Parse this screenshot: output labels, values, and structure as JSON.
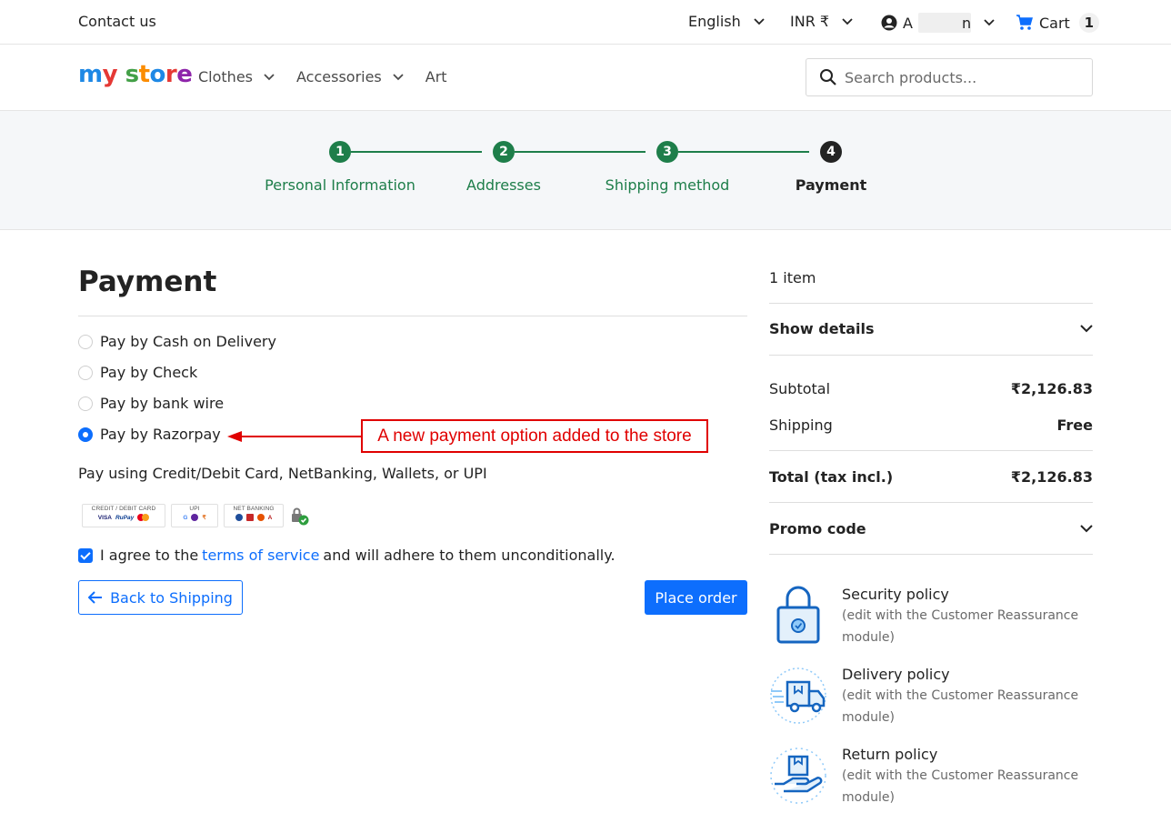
{
  "topbar": {
    "contact": "Contact us",
    "language": "English",
    "currency": "INR ₹",
    "account_initial": "A",
    "account_tail": "n",
    "cart_label": "Cart",
    "cart_count": "1"
  },
  "header": {
    "logo": {
      "my": "my",
      "store": "store"
    },
    "nav": [
      "Clothes",
      "Accessories",
      "Art"
    ],
    "search_placeholder": "Search products..."
  },
  "steps": [
    {
      "num": "1",
      "label": "Personal Information",
      "state": "done"
    },
    {
      "num": "2",
      "label": "Addresses",
      "state": "done"
    },
    {
      "num": "3",
      "label": "Shipping method",
      "state": "done"
    },
    {
      "num": "4",
      "label": "Payment",
      "state": "current"
    }
  ],
  "payment": {
    "title": "Payment",
    "options": [
      {
        "label": "Pay by Cash on Delivery",
        "checked": false
      },
      {
        "label": "Pay by Check",
        "checked": false
      },
      {
        "label": "Pay by bank wire",
        "checked": false
      },
      {
        "label": "Pay by Razorpay",
        "checked": true
      }
    ],
    "annotation": "A new payment option added to the store",
    "description": "Pay using Credit/Debit Card, NetBanking, Wallets, or UPI",
    "badges": {
      "card": "CREDIT / DEBIT CARD",
      "visa": "VISA",
      "rupay": "RuPay",
      "upi": "UPI",
      "netbanking": "NET BANKING"
    },
    "agree_prefix": "I agree to the",
    "agree_link": "terms of service",
    "agree_suffix": "and will adhere to them unconditionally.",
    "back_label": "Back to Shipping",
    "place_label": "Place order"
  },
  "summary": {
    "items": "1 item",
    "show_details": "Show details",
    "subtotal_label": "Subtotal",
    "subtotal_value": "₹2,126.83",
    "shipping_label": "Shipping",
    "shipping_value": "Free",
    "total_label": "Total (tax incl.)",
    "total_value": "₹2,126.83",
    "promo": "Promo code"
  },
  "reassurance": [
    {
      "title": "Security policy",
      "sub": "(edit with the Customer Reassurance module)",
      "icon": "lock-icon"
    },
    {
      "title": "Delivery policy",
      "sub": "(edit with the Customer Reassurance module)",
      "icon": "truck-icon"
    },
    {
      "title": "Return policy",
      "sub": "(edit with the Customer Reassurance module)",
      "icon": "hand-box-icon"
    }
  ],
  "colors": {
    "accent": "#0d6efd",
    "step_green": "#1e7e4a",
    "annotation_red": "#e00000"
  }
}
